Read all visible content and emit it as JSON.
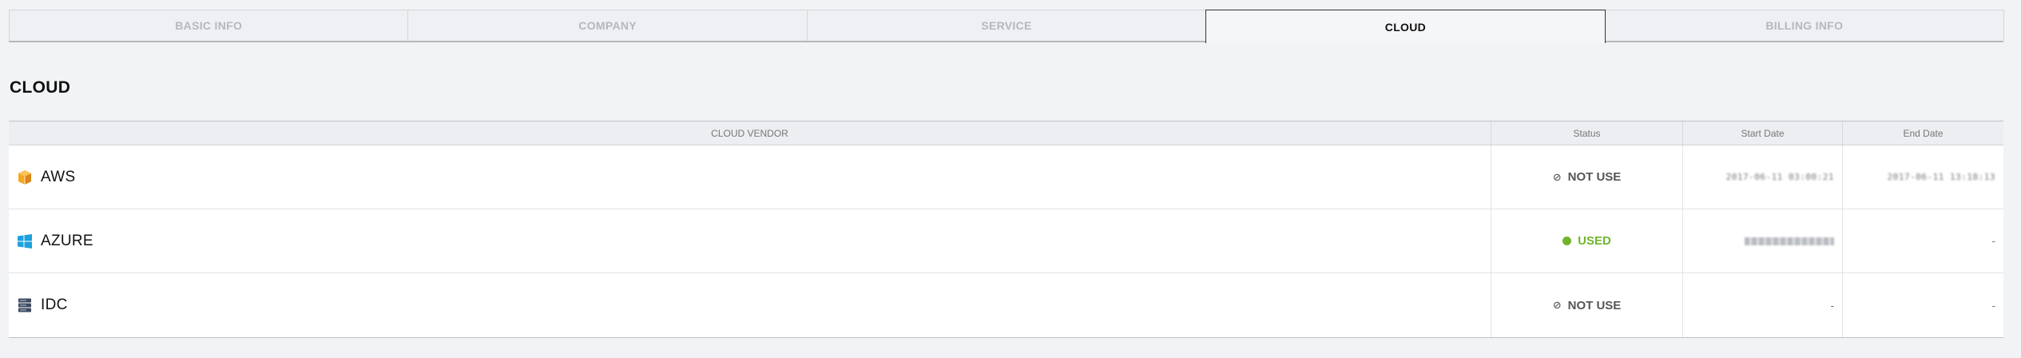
{
  "tabs": [
    {
      "label": "BASIC INFO",
      "active": false
    },
    {
      "label": "COMPANY",
      "active": false
    },
    {
      "label": "SERVICE",
      "active": false
    },
    {
      "label": "CLOUD",
      "active": true
    },
    {
      "label": "BILLING INFO",
      "active": false
    }
  ],
  "section": {
    "title": "CLOUD"
  },
  "table": {
    "headers": {
      "vendor": "CLOUD VENDOR",
      "status": "Status",
      "start": "Start Date",
      "end": "End Date"
    },
    "rows": [
      {
        "vendor": "AWS",
        "icon": "aws-box-icon",
        "status": "NOT USE",
        "start": "2017-06-11 03:00:21",
        "end": "2017-06-11 13:18:13"
      },
      {
        "vendor": "AZURE",
        "icon": "windows-icon",
        "status": "USED",
        "start": "",
        "end": "-"
      },
      {
        "vendor": "IDC",
        "icon": "server-icon",
        "status": "NOT USE",
        "start": "-",
        "end": "-"
      }
    ]
  },
  "colors": {
    "used": "#6fb52c",
    "aws": "#f5a623",
    "azure": "#1ea1de",
    "idc": "#3c4a5e"
  }
}
